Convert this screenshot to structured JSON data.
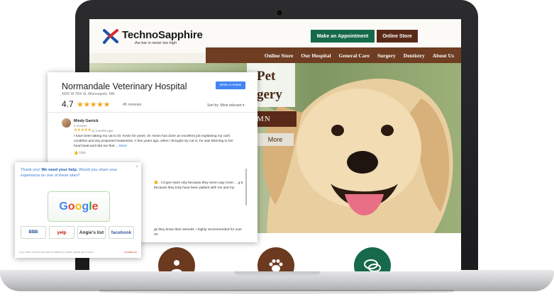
{
  "site": {
    "brand": "TechnoSapphire",
    "tagline": "the bar is never too high",
    "header_buttons": {
      "appointment": "Make an Appointment",
      "store": "Online Store"
    },
    "nav": [
      "Online Store",
      "Our Hospital",
      "General Care",
      "Surgery",
      "Dentistry",
      "About Us"
    ],
    "hero": {
      "line1": "Pet",
      "line2": "gery",
      "band": "MN",
      "more": "More"
    },
    "colors": {
      "green": "#16694a",
      "brown": "#5a2a18",
      "nav_brown": "#6e3d22"
    },
    "service_icons": [
      "doctor-icon",
      "paw-icon",
      "chat-icon"
    ]
  },
  "reviews": {
    "title": "Normandale Veterinary Hospital",
    "address": "4000 W 76th St, Minneapolis, MN",
    "write_button": "Write a review",
    "rating": "4.7",
    "stars": "★★★★★",
    "count": "45 reviews",
    "sort": "Sort by: Most relevant ▾",
    "first": {
      "name": "Mindy Garrick",
      "sub": "2 reviews",
      "stars": "★★★★★",
      "time": "11 months ago",
      "text": "I have been taking my cat to Dr. Kevin for years. Dr. Kevin has done an excellent job explaining my cat's condition and any proposed treatments. A few years ago, when I brought my cat in, he was listening to her heart beat and told me that ... ",
      "more": "More",
      "like": "Like"
    },
    "fragment1": "🙂 . I'd give stars only because they seem way more ... g 5 because they truly have been patient with me and my",
    "fragment2": "gs they know their animals. I highly recommended for over 20"
  },
  "popup": {
    "message_a": "Thank you! ",
    "message_b": "We need your help.",
    "message_c": " Would you share your experience on one of these sites?",
    "google": [
      "G",
      "o",
      "o",
      "g",
      "l",
      "e"
    ],
    "sites": [
      "yelp",
      "Angie's list",
      "facebook"
    ],
    "bbb": "BBB",
    "footer_left": "If you have concerns you wish to address in private, please get in touch",
    "footer_right": "Contact Us",
    "close": "×"
  }
}
